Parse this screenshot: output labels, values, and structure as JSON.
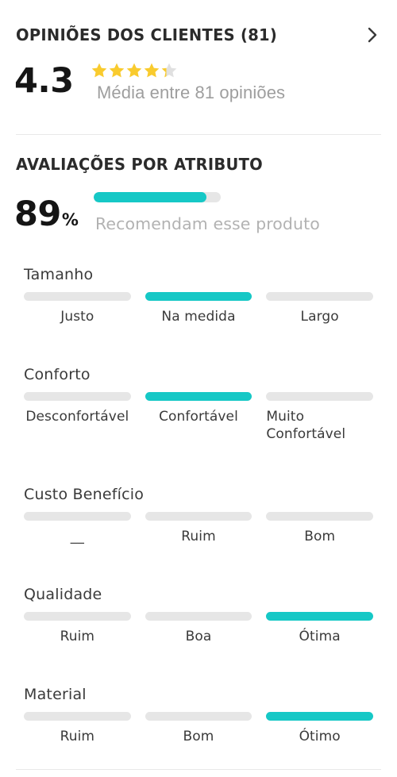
{
  "header": {
    "title": "OPINIÕES DOS CLIENTES (81)",
    "chevron_icon": "chevron-right-icon"
  },
  "rating": {
    "score": "4.3",
    "stars_filled": 4.3,
    "stars_total": 5,
    "star_color": "#f9cb2e",
    "star_empty_color": "#e0e0e0",
    "average_text": "Média entre 81 opiniões",
    "review_count": 81
  },
  "attributes_section": {
    "heading": "AVALIAÇÕES POR ATRIBUTO",
    "recommend": {
      "percent_value": "89",
      "percent_symbol": "%",
      "percent_number": 89,
      "label": "Recomendam esse produto",
      "bar_color": "#16c8c6",
      "track_color": "#e6e6e6"
    },
    "items": [
      {
        "name": "Tamanho",
        "selected_index": 1,
        "options": [
          "Justo",
          "Na medida",
          "Largo"
        ]
      },
      {
        "name": "Conforto",
        "selected_index": 1,
        "options": [
          "Desconfortável",
          "Confortável",
          "Muito Confortável"
        ]
      },
      {
        "name": "Custo Benefício",
        "selected_index": -1,
        "options": [
          "__",
          "Ruim",
          "Bom"
        ]
      },
      {
        "name": "Qualidade",
        "selected_index": 2,
        "options": [
          "Ruim",
          "Boa",
          "Ótima"
        ]
      },
      {
        "name": "Material",
        "selected_index": 2,
        "options": [
          "Ruim",
          "Bom",
          "Ótimo"
        ]
      }
    ]
  },
  "colors": {
    "accent": "#16c8c6",
    "text_primary": "#2b2b2b",
    "text_muted": "#9e9e9e",
    "track": "#e6e6e6",
    "divider": "#e9e9e9"
  }
}
